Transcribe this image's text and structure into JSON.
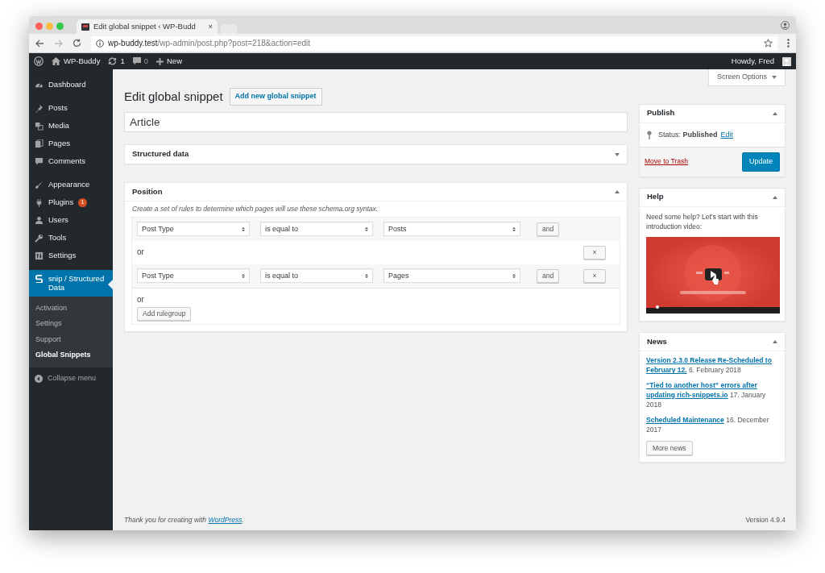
{
  "browser": {
    "tab_title": "Edit global snippet ‹ WP-Budd",
    "close": "×",
    "address_host": "wp-buddy.test",
    "address_path": "/wp-admin/post.php?post=218&action=edit"
  },
  "admin_bar": {
    "site_name": "WP-Buddy",
    "updates": "1",
    "comments": "0",
    "new": "New",
    "greeting": "Howdy, Fred"
  },
  "sidebar": {
    "sections": [
      [
        {
          "label": "Dashboard",
          "selected": false
        }
      ],
      [
        {
          "label": "Posts",
          "selected": false
        },
        {
          "label": "Media",
          "selected": false
        },
        {
          "label": "Pages",
          "selected": false
        },
        {
          "label": "Comments",
          "selected": false
        }
      ],
      [
        {
          "label": "Appearance",
          "selected": false
        },
        {
          "label": "Plugins",
          "selected": false,
          "badge": "1"
        },
        {
          "label": "Users",
          "selected": false
        },
        {
          "label": "Tools",
          "selected": false
        },
        {
          "label": "Settings",
          "selected": false
        }
      ],
      [
        {
          "label": "snip / Structured Data",
          "selected": true
        }
      ]
    ],
    "submenu": [
      {
        "label": "Activation",
        "selected": false
      },
      {
        "label": "Settings",
        "selected": false
      },
      {
        "label": "Support",
        "selected": false
      },
      {
        "label": "Global Snippets",
        "selected": true
      }
    ],
    "collapse": "Collapse menu"
  },
  "screen_options": "Screen Options",
  "heading": "Edit global snippet",
  "add_new": "Add new global snippet",
  "post_title": "Article",
  "panels": [
    {
      "title": "Structured data",
      "expanded": false
    },
    {
      "title": "Position",
      "expanded": true,
      "description": "Create a set of rules to determine which pages will use these schema.org syntax.",
      "rows": [
        {
          "kind": "rule",
          "param": "Post Type",
          "operator": "is equal to",
          "value": "Posts",
          "and": "and"
        },
        {
          "kind": "or",
          "label": "or",
          "remove": "×"
        },
        {
          "kind": "rule",
          "param": "Post Type",
          "operator": "is equal to",
          "value": "Pages",
          "and": "and",
          "remove": "×"
        },
        {
          "kind": "add",
          "label": "or",
          "button": "Add rulegroup"
        }
      ]
    }
  ],
  "publish": {
    "title": "Publish",
    "expanded": true,
    "status_label": "Status:",
    "status_value": "Published",
    "edit": "Edit",
    "trash": "Move to Trash",
    "update": "Update"
  },
  "help": {
    "title": "Help",
    "expanded": true,
    "text": "Need some help? Let's start with this introduction video:"
  },
  "news": {
    "title": "News",
    "expanded": true,
    "items": [
      {
        "link": "Version 2.3.0 Release Re-Scheduled to February 12.",
        "date": "6. February 2018"
      },
      {
        "link": "“Tied to another host” errors after updating rich-snippets.io",
        "date": "17. January 2018"
      },
      {
        "link": "Scheduled Maintenance",
        "date": "16. December 2017"
      }
    ],
    "more": "More news"
  },
  "footer": {
    "thanks_before": "Thank you for creating with ",
    "thanks_link": "WordPress",
    "thanks_after": ".",
    "version": "Version 4.9.4"
  }
}
